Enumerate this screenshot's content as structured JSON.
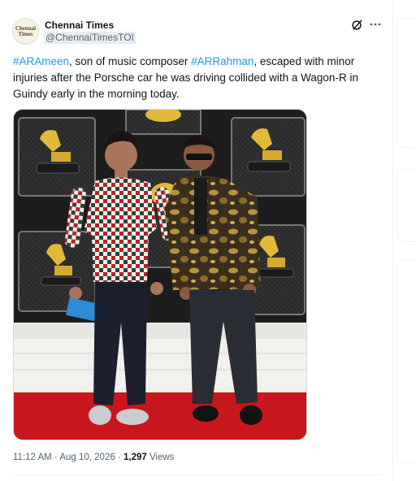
{
  "account": {
    "name": "Chennai Times",
    "handle": "@ChennaiTimesTOI",
    "avatar_line1": "Chennai",
    "avatar_line2": "Times"
  },
  "tweet": {
    "hashtag_1": "#ARAmeen",
    "text_1": ", son of music composer ",
    "hashtag_2": "#ARRahman",
    "text_2": ", escaped with minor injuries after the Porsche car he was driving collided with a Wagon-R in Guindy early in the morning today."
  },
  "meta": {
    "timestamp": "11:12 AM · Aug 10, 2026",
    "separator": " · ",
    "views_count": "1,297",
    "views_label": " Views"
  },
  "icons": {
    "grok": "grok-icon",
    "more": "more-options-icon"
  },
  "colors": {
    "link": "#1d9bf0",
    "secondary_text": "#536471",
    "carpet": "#c8161d"
  }
}
